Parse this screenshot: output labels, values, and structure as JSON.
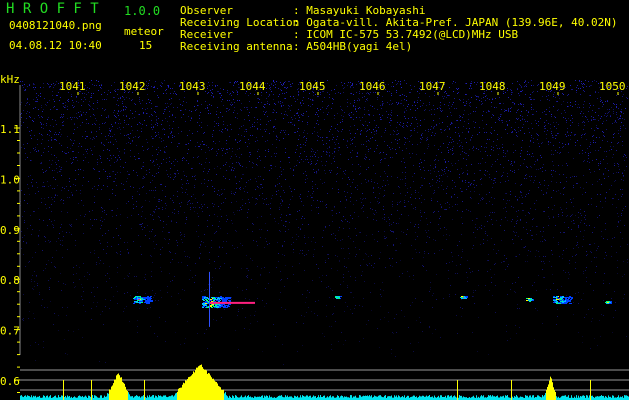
{
  "header": {
    "app_title": "H R O F F T",
    "version": "1.0.0",
    "filename": "0408121040.png",
    "datetime": "04.08.12 10:40",
    "meteor_label": "meteor",
    "meteor_count": "15"
  },
  "info": {
    "observer_label": "Observer",
    "observer": ": Masayuki Kobayashi",
    "location_label": "Receiving Location",
    "location": ": Ogata-vill. Akita-Pref. JAPAN (139.96E, 40.02N)",
    "receiver_label": "Receiver",
    "receiver": ": ICOM IC-575 53.7492(@LCD)MHz USB",
    "antenna_label": "Receiving antenna",
    "antenna": ": A504HB(yagi 4el)"
  },
  "colors": {
    "text": "#ffff00",
    "title": "#22dd22",
    "noise": "#1a1aa0",
    "hot": "#ff2080",
    "histogram": "#ffff00",
    "histogram_low": "#00e5ee"
  },
  "chart_data": {
    "type": "heatmap",
    "ylabel": "kHz",
    "x_ticks": [
      "1041",
      "1042",
      "1043",
      "1044",
      "1045",
      "1046",
      "1047",
      "1048",
      "1049",
      "1050"
    ],
    "y_ticks": [
      "1.1",
      "1.0",
      "0.9",
      "0.8",
      "0.7",
      "0.6"
    ],
    "ylim": [
      0.58,
      1.2
    ],
    "events": [
      {
        "time": "1042.0",
        "freq": 0.76,
        "strength": "medium"
      },
      {
        "time": "1043.2",
        "freq": 0.755,
        "strength": "strong"
      },
      {
        "time": "1045.3",
        "freq": 0.765,
        "strength": "weak"
      },
      {
        "time": "1047.4",
        "freq": 0.765,
        "strength": "weak"
      },
      {
        "time": "1048.5",
        "freq": 0.76,
        "strength": "weak"
      },
      {
        "time": "1049.0",
        "freq": 0.76,
        "strength": "medium"
      },
      {
        "time": "1049.8",
        "freq": 0.755,
        "strength": "weak"
      }
    ]
  }
}
